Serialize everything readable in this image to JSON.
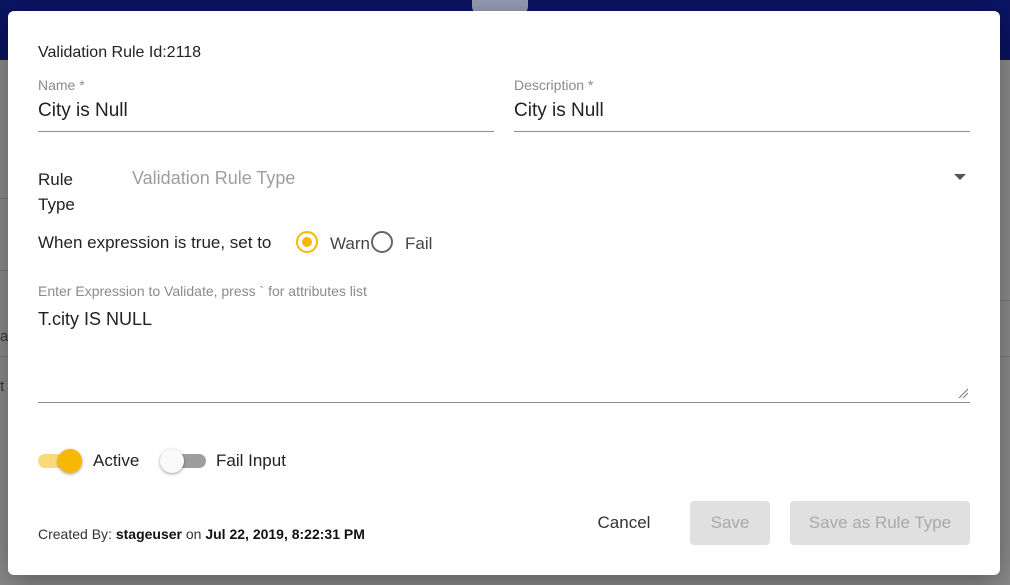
{
  "dialog": {
    "title": "Validation Rule Id:2118",
    "name": {
      "label": "Name *",
      "value": "City is Null"
    },
    "description": {
      "label": "Description *",
      "value": "City is Null"
    },
    "rule_type": {
      "label_line1": "Rule",
      "label_line2": "Type",
      "placeholder": "Validation Rule Type"
    },
    "when_expression": {
      "label": "When expression is true, set to",
      "options": [
        {
          "label": "Warn",
          "selected": true
        },
        {
          "label": "Fail",
          "selected": false
        }
      ]
    },
    "expression": {
      "label": "Enter Expression to Validate, press ` for attributes list",
      "value": "T.city IS NULL"
    },
    "toggles": {
      "active": {
        "label": "Active",
        "on": true
      },
      "fail_input": {
        "label": "Fail Input",
        "on": false
      }
    },
    "footer": {
      "created_by_prefix": "Created By:",
      "created_by_user": "stageuser",
      "on_word": "on",
      "created_date": "Jul 22, 2019, 8:22:31 PM"
    },
    "buttons": {
      "cancel": "Cancel",
      "save": "Save",
      "save_as_rule_type": "Save as Rule Type"
    }
  },
  "background": {
    "fragment_a": "ar",
    "fragment_b": "t"
  },
  "colors": {
    "accent": "#f6b800",
    "header": "#0a1462",
    "disabled_button": "#e0e0e0"
  }
}
